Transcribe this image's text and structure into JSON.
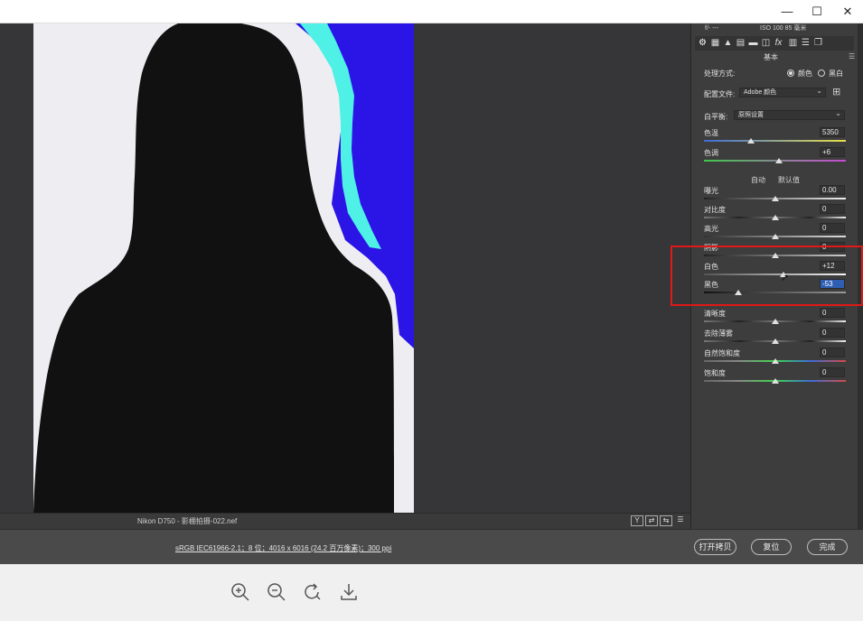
{
  "window": {
    "minimize": "—",
    "maximize": "☐",
    "close": "✕"
  },
  "status": {
    "filename": "Nikon D750 -  影棚拍摄-022.nef",
    "view_buttons": [
      "Y",
      "⇄",
      "⇆",
      "☰"
    ]
  },
  "bottom": {
    "workflow": "sRGB IEC61966-2.1；8 位；4016 x 6016 (24.2 百万像素)；300 ppi",
    "open_copy": "打开拷贝",
    "reset": "复位",
    "done": "完成"
  },
  "panel": {
    "exif_left": "f/-  ---",
    "exif_right": "ISO 100   85 毫米",
    "section": "基本",
    "process_label": "处理方式:",
    "process_color": "颜色",
    "process_bw": "黑白",
    "profile_label": "配置文件:",
    "profile_value": "Adobe 颜色",
    "wb_label": "白平衡:",
    "wb_value": "原照设置",
    "temp_label": "色温",
    "temp_value": "5350",
    "tint_label": "色调",
    "tint_value": "+6",
    "auto": "自动",
    "default": "默认值",
    "exposure_label": "曝光",
    "exposure_value": "0.00",
    "contrast_label": "对比度",
    "contrast_value": "0",
    "highlights_label": "高光",
    "highlights_value": "0",
    "shadows_label": "阴影",
    "shadows_value": "0",
    "whites_label": "白色",
    "whites_value": "+12",
    "blacks_label": "黑色",
    "blacks_value": "-53",
    "clarity_label": "清晰度",
    "clarity_value": "0",
    "dehaze_label": "去除薄雾",
    "dehaze_value": "0",
    "vibrance_label": "自然饱和度",
    "vibrance_value": "0",
    "saturation_label": "饱和度",
    "saturation_value": "0"
  },
  "sliders": {
    "temperature": 0.33,
    "tint": 0.53,
    "exposure": 0.5,
    "contrast": 0.5,
    "highlights": 0.5,
    "shadows": 0.5,
    "whites": 0.56,
    "blacks": 0.24,
    "clarity": 0.5,
    "dehaze": 0.5,
    "vibrance": 0.5,
    "saturation": 0.5
  },
  "icons": {
    "tabs": [
      "basic-tab-icon",
      "tone-curve-tab-icon",
      "detail-tab-icon",
      "hsl-tab-icon",
      "split-toning-tab-icon",
      "lens-tab-icon",
      "fx-tab-icon",
      "calibration-tab-icon",
      "presets-tab-icon",
      "snapshots-tab-icon"
    ],
    "viewer": [
      "zoom-in-icon",
      "zoom-out-icon",
      "rotate-icon",
      "download-icon"
    ]
  },
  "colors": {
    "highlight_box": "#e01818",
    "clip_blue": "#2a14e6",
    "clip_cyan": "#4ff0e6",
    "selection": "#2e5fb3"
  }
}
